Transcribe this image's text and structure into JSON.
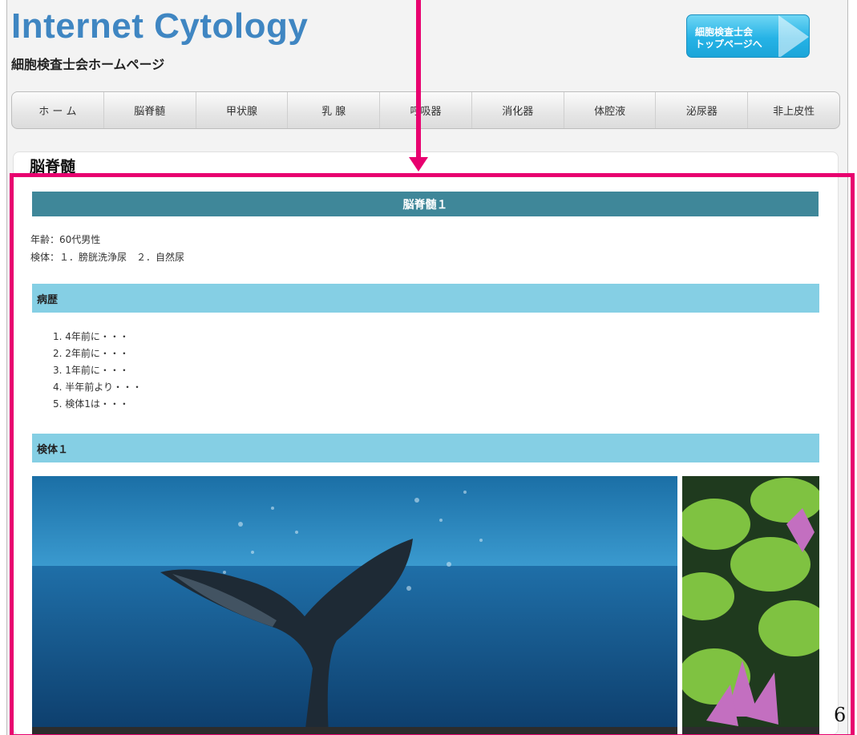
{
  "header": {
    "logo": "Internet Cytology",
    "subtitle": "細胞検査士会ホームページ",
    "top_button_line1": "細胞検査士会",
    "top_button_line2": "トップページへ"
  },
  "nav": {
    "items": [
      "ホ ー ム",
      "脳脊髄",
      "甲状腺",
      "乳 腺",
      "呼吸器",
      "消化器",
      "体腔液",
      "泌尿器",
      "非上皮性"
    ]
  },
  "page": {
    "section_title": "脳脊髄",
    "case_title": "脳脊髄１",
    "age": "年齢：60代男性",
    "specimen": "検体：１．膀胱洗浄尿　２．自然尿"
  },
  "history": {
    "title": "病歴",
    "items": [
      "4年前に・・・",
      "2年前に・・・",
      "1年前に・・・",
      "半年前より・・・",
      "検体1は・・・"
    ]
  },
  "specimen1": {
    "title": "検体１"
  },
  "images": {
    "main": "whale-tail-photo",
    "side": "water-lily-photo"
  },
  "slide_number": "6",
  "colors": {
    "accent_pink": "#e8006f",
    "case_bar": "#3f8799",
    "sub_bar": "#85cfe4",
    "logo_blue": "#3f86c2"
  }
}
